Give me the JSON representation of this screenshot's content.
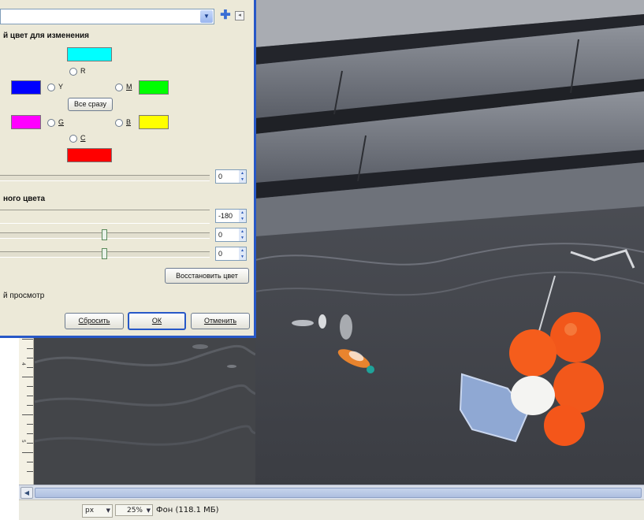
{
  "dialog": {
    "preset_value": "",
    "section_primary_title": "й цвет для изменения",
    "radio_labels": {
      "r": "R",
      "y": "Y",
      "m": "M",
      "g": "G",
      "b": "B",
      "c": "C"
    },
    "all_at_once_label": "Все сразу",
    "overlap_value": "0",
    "section_adjust_title": "ного цвета",
    "hue_value": "-180",
    "lightness_value": "0",
    "saturation_value": "0",
    "restore_color_label": "Восстановить цвет",
    "preview_label": "й просмотр",
    "reset_label": "Сбросить",
    "ok_label": "ОК",
    "cancel_label": "Отменить",
    "colors": {
      "cyan": "#00ffff",
      "blue": "#0000ff",
      "green": "#00ff00",
      "magenta": "#ff00ff",
      "yellow": "#ffff00",
      "red": "#ff0000",
      "frame": "#2758c7"
    }
  },
  "status_bar": {
    "unit": "px",
    "zoom": "25%",
    "info": "Фон (118.1 МБ)"
  },
  "ruler": {
    "labels": [
      "4",
      "5"
    ]
  }
}
